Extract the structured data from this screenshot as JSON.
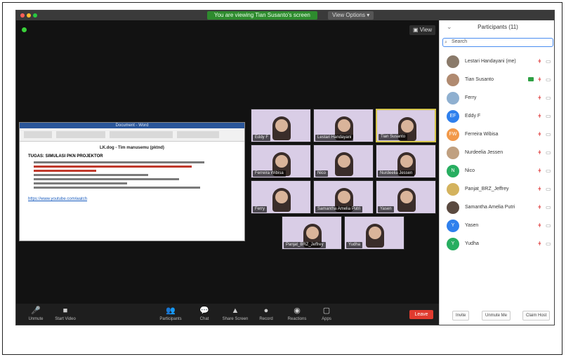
{
  "window": {
    "recording_banner": "You are viewing Tian Susanto's screen",
    "view_options": "View Options ▾",
    "view_button": "▣ View"
  },
  "document": {
    "title": "Document - Word",
    "heading": "LK.dog - Tim manusemu (pktnd)",
    "subheading": "TUGAS: SIMULASI PKN PROJEKTOR",
    "link": "https://www.youtube.com/watch"
  },
  "tiles": [
    {
      "name": "Eddy F",
      "active": false
    },
    {
      "name": "Lestari Handayani",
      "active": false
    },
    {
      "name": "Tian Susanto",
      "active": true
    },
    {
      "name": "Ferreira Wibisa",
      "active": false
    },
    {
      "name": "Nico",
      "active": false
    },
    {
      "name": "Nurdeelia Jessen",
      "active": false
    },
    {
      "name": "Ferry",
      "active": false
    },
    {
      "name": "Samantha Amelia Putri",
      "active": false
    },
    {
      "name": "Yasen",
      "active": false
    },
    {
      "name": "Panjat_BRZ_Jeffrey",
      "active": false
    },
    {
      "name": "Yudha",
      "active": false
    }
  ],
  "toolbar": {
    "items": [
      {
        "icon": "🎤",
        "label": "Unmute"
      },
      {
        "icon": "■",
        "label": "Start Video"
      },
      {
        "icon": "👥",
        "label": "Participants"
      },
      {
        "icon": "💬",
        "label": "Chat"
      },
      {
        "icon": "▲",
        "label": "Share Screen"
      },
      {
        "icon": "●",
        "label": "Record"
      },
      {
        "icon": "◉",
        "label": "Reactions"
      },
      {
        "icon": "▢",
        "label": "Apps"
      }
    ],
    "leave": "Leave"
  },
  "panel": {
    "title": "Participants (11)",
    "search_placeholder": "Search",
    "participants": [
      {
        "name": "Lestari Handayani (me)",
        "initials": "",
        "color": "#8a7a6a"
      },
      {
        "name": "Tian Susanto",
        "initials": "",
        "color": "#b08a70"
      },
      {
        "name": "Ferry",
        "initials": "",
        "color": "#8fb0d0"
      },
      {
        "name": "Eddy F",
        "initials": "EF",
        "color": "#2f80ed"
      },
      {
        "name": "Ferreira Wibisa",
        "initials": "FW",
        "color": "#f2994a"
      },
      {
        "name": "Nurdeelia Jessen",
        "initials": "",
        "color": "#c0a080"
      },
      {
        "name": "Nico",
        "initials": "N",
        "color": "#27ae60"
      },
      {
        "name": "Panjat_BRZ_Jeffrey",
        "initials": "",
        "color": "#d4b35e"
      },
      {
        "name": "Samantha Amelia Putri",
        "initials": "",
        "color": "#5a4a40"
      },
      {
        "name": "Yasen",
        "initials": "Y",
        "color": "#2f80ed"
      },
      {
        "name": "Yudha",
        "initials": "Y",
        "color": "#27ae60"
      }
    ],
    "footer": [
      "Invite",
      "Unmute Me",
      "Claim Host"
    ]
  }
}
